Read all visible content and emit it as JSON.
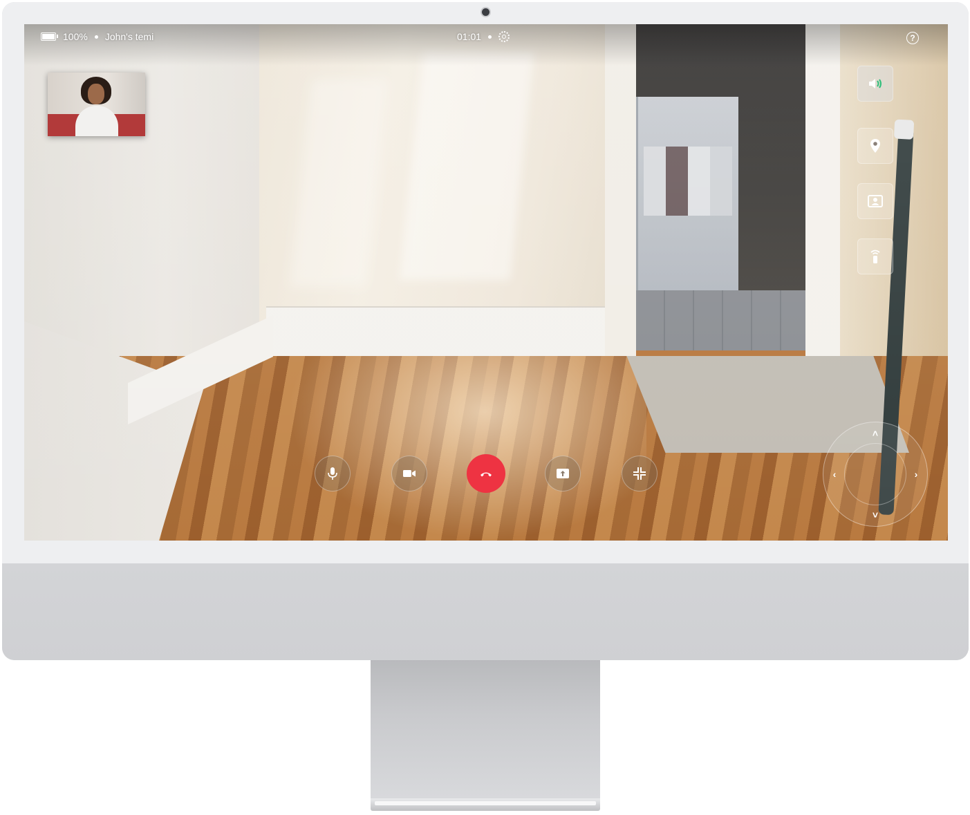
{
  "status_bar": {
    "battery_level": "100%",
    "robot_name": "John's temi",
    "call_timer": "01:01"
  },
  "side_controls": [
    {
      "name": "volume",
      "icon": "speaker-icon",
      "active": true,
      "accent": "#2fbf7a"
    },
    {
      "name": "locations",
      "icon": "location-pin-icon",
      "active": false
    },
    {
      "name": "contacts",
      "icon": "contact-card-icon",
      "active": false
    },
    {
      "name": "remote-control",
      "icon": "remote-icon",
      "active": false
    }
  ],
  "call_controls": [
    {
      "name": "microphone",
      "icon": "microphone-icon"
    },
    {
      "name": "camera",
      "icon": "video-camera-icon"
    },
    {
      "name": "hang-up",
      "icon": "phone-hangup-icon",
      "color": "#ee3342"
    },
    {
      "name": "share-screen",
      "icon": "share-screen-icon"
    },
    {
      "name": "exit-fullscreen",
      "icon": "minimize-icon"
    }
  ],
  "joystick": {
    "up": "˄",
    "down": "˅",
    "left": "‹",
    "right": "›"
  },
  "help": {
    "label": "?"
  }
}
